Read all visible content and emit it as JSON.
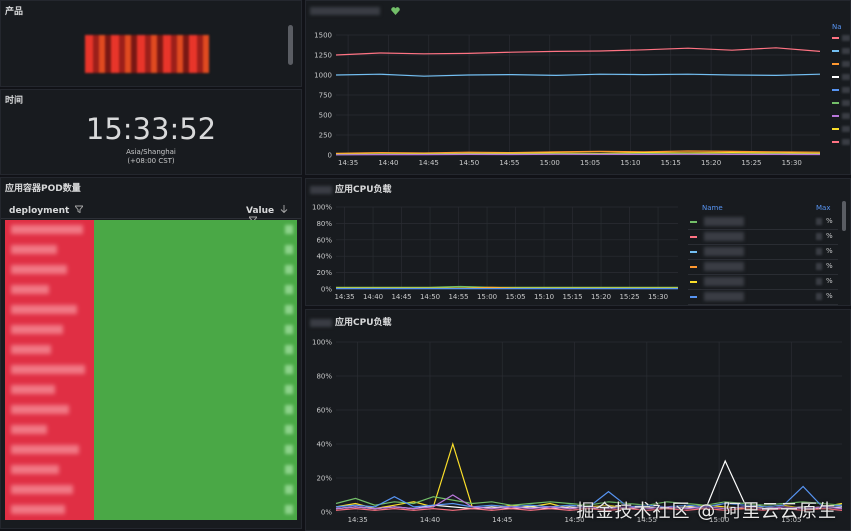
{
  "panels": {
    "product": {
      "title": "产品"
    },
    "time": {
      "title": "时间",
      "clock": "15:33:52",
      "tz": "Asia/Shanghai",
      "offset": "(+08:00 CST)"
    },
    "pods": {
      "title": "应用容器POD数量",
      "col_deployment": "deployment",
      "col_value": "Value"
    },
    "top_chart": {
      "legend_header": "Na"
    },
    "cpu1": {
      "title": "应用CPU负载",
      "legend_name": "Name",
      "legend_max": "Max",
      "legend_unit": "%"
    },
    "cpu2": {
      "title": "应用CPU负载"
    }
  },
  "icons": {
    "filter": "filter-icon",
    "sort": "sort-desc-icon",
    "status": "heart-icon"
  },
  "colors": {
    "bg": "#111217",
    "panel": "#181b1f",
    "red_cells": "#e02f44",
    "green_cells": "#4aa846",
    "accent": "#5794f2"
  },
  "watermark": "掘金技术社区 @ 阿里云云原生",
  "chart_data": [
    {
      "type": "line",
      "x": [
        "14:35",
        "14:40",
        "14:45",
        "14:50",
        "14:55",
        "15:00",
        "15:05",
        "15:10",
        "15:15",
        "15:20",
        "15:25",
        "15:30"
      ],
      "ylim": [
        0,
        1500
      ],
      "yticks": [
        "0",
        "250",
        "500",
        "750",
        "1000",
        "1250",
        "1500"
      ],
      "grid": true,
      "series": [
        {
          "color": "#ff7383",
          "values": [
            1250,
            1275,
            1265,
            1270,
            1285,
            1295,
            1300,
            1315,
            1335,
            1310,
            1340,
            1295
          ]
        },
        {
          "color": "#73bff2",
          "values": [
            1000,
            1010,
            985,
            1000,
            1005,
            995,
            1010,
            1005,
            1010,
            1000,
            995,
            1010
          ]
        },
        {
          "color": "#ff9830",
          "values": [
            20,
            30,
            25,
            35,
            30,
            40,
            45,
            40,
            50,
            45,
            40,
            35
          ]
        },
        {
          "color": "#fade2a",
          "values": [
            10,
            15,
            15,
            20,
            20,
            25,
            20,
            30,
            25,
            30,
            25,
            20
          ]
        },
        {
          "color": "#73bf69",
          "values": [
            5,
            10,
            8,
            12,
            10,
            15,
            12,
            18,
            15,
            12,
            14,
            10
          ]
        },
        {
          "color": "#b877d9",
          "values": [
            3,
            5,
            5,
            8,
            6,
            9,
            7,
            8,
            9,
            7,
            8,
            6
          ]
        }
      ]
    },
    {
      "type": "line",
      "x": [
        "14:35",
        "14:40",
        "14:45",
        "14:50",
        "14:55",
        "15:00",
        "15:05",
        "15:10",
        "15:15",
        "15:20",
        "15:25",
        "15:30"
      ],
      "ylim": [
        0,
        100
      ],
      "yticks": [
        "0%",
        "20%",
        "40%",
        "60%",
        "80%",
        "100%"
      ],
      "grid": true,
      "series": [
        {
          "color": "#73bf69",
          "values": [
            2,
            2,
            2,
            2,
            3,
            2,
            2,
            2,
            2,
            2,
            2,
            2
          ]
        },
        {
          "color": "#ff9830",
          "values": [
            1,
            1,
            1,
            1,
            1,
            2,
            1,
            1,
            1,
            1,
            1,
            1
          ]
        },
        {
          "color": "#fade2a",
          "values": [
            1,
            1,
            1,
            1,
            1,
            1,
            1,
            1,
            1,
            1,
            1,
            1
          ]
        },
        {
          "color": "#5794f2",
          "values": [
            0.5,
            0.5,
            0.5,
            0.5,
            0.5,
            0.5,
            0.5,
            0.5,
            0.5,
            0.5,
            0.5,
            0.5
          ]
        }
      ]
    },
    {
      "type": "line",
      "x": [
        "14:35",
        "14:40",
        "14:45",
        "14:50",
        "14:55",
        "15:00",
        "15:05"
      ],
      "ylim": [
        0,
        100
      ],
      "yticks": [
        "0%",
        "20%",
        "40%",
        "60%",
        "80%",
        "100%"
      ],
      "grid": true,
      "series": [
        {
          "color": "#fade2a",
          "values": [
            3,
            5,
            2,
            4,
            6,
            3,
            40,
            3,
            2,
            4,
            3,
            5,
            2,
            3,
            4,
            2,
            3,
            2,
            3,
            4,
            3,
            2,
            3,
            4,
            2,
            3,
            5
          ]
        },
        {
          "color": "#ffffff",
          "values": [
            2,
            3,
            2,
            3,
            2,
            4,
            3,
            2,
            3,
            2,
            3,
            2,
            3,
            2,
            3,
            2,
            3,
            2,
            3,
            2,
            30,
            5,
            3,
            2,
            3,
            2,
            3
          ]
        },
        {
          "color": "#73bf69",
          "values": [
            5,
            8,
            4,
            6,
            5,
            9,
            7,
            5,
            6,
            4,
            5,
            6,
            5,
            4,
            6,
            5,
            4,
            6,
            5,
            4,
            6,
            5,
            4,
            5,
            6,
            5,
            4
          ]
        },
        {
          "color": "#5794f2",
          "values": [
            3,
            4,
            3,
            9,
            3,
            4,
            5,
            3,
            4,
            3,
            4,
            3,
            4,
            3,
            12,
            3,
            4,
            3,
            4,
            3,
            5,
            4,
            3,
            4,
            15,
            3,
            4
          ]
        },
        {
          "color": "#ff7383",
          "values": [
            1,
            2,
            1,
            2,
            1,
            2,
            1,
            2,
            1,
            2,
            1,
            2,
            1,
            2,
            1,
            2,
            1,
            2,
            1,
            2,
            1,
            2,
            1,
            2,
            1,
            2,
            1
          ]
        },
        {
          "color": "#b877d9",
          "values": [
            2,
            3,
            2,
            3,
            2,
            3,
            10,
            3,
            2,
            3,
            2,
            3,
            2,
            3,
            2,
            3,
            2,
            3,
            2,
            3,
            2,
            3,
            2,
            3,
            2,
            3,
            2
          ]
        }
      ]
    }
  ]
}
